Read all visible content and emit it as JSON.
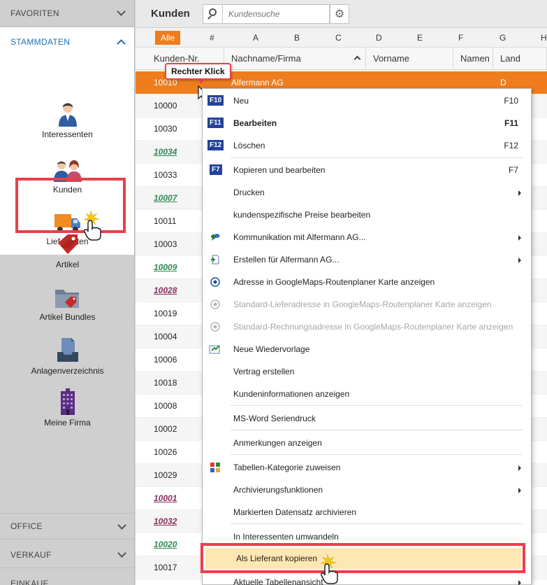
{
  "sidebar": {
    "favoriten": "FAVORITEN",
    "stammdaten": "STAMMDATEN",
    "items": [
      {
        "label": "Interessenten"
      },
      {
        "label": "Kunden"
      },
      {
        "label": "Lieferanten"
      },
      {
        "label": "Artikel"
      },
      {
        "label": "Artikel Bundles"
      },
      {
        "label": "Anlagenverzeichnis"
      },
      {
        "label": "Meine Firma"
      }
    ],
    "office": "OFFICE",
    "verkauf": "VERKAUF",
    "einkauf": "EINKAUF"
  },
  "header": {
    "title": "Kunden",
    "search_placeholder": "Kundensuche"
  },
  "letters": [
    "Alle",
    "#",
    "A",
    "B",
    "C",
    "D",
    "E",
    "F",
    "G",
    "H"
  ],
  "columns": {
    "nr": "Kunden-Nr.",
    "name": "Nachname/Firma",
    "vorname": "Vorname",
    "namen": "Namen",
    "land": "Land"
  },
  "rows": [
    {
      "nr": "10010",
      "name": "Alfermann AG",
      "land": "D"
    },
    {
      "nr": "10000"
    },
    {
      "nr": "10030"
    },
    {
      "nr": "10034"
    },
    {
      "nr": "10033"
    },
    {
      "nr": "10007"
    },
    {
      "nr": "10011"
    },
    {
      "nr": "10003"
    },
    {
      "nr": "10009"
    },
    {
      "nr": "10028"
    },
    {
      "nr": "10019"
    },
    {
      "nr": "10004"
    },
    {
      "nr": "10006"
    },
    {
      "nr": "10018"
    },
    {
      "nr": "10008"
    },
    {
      "nr": "10002"
    },
    {
      "nr": "10026"
    },
    {
      "nr": "10029"
    },
    {
      "nr": "10001"
    },
    {
      "nr": "10032"
    },
    {
      "nr": "10020"
    },
    {
      "nr": "10017"
    }
  ],
  "callout": "Rechter Klick",
  "menu": {
    "neu": "Neu",
    "neu_key": "F10",
    "bearbeiten": "Bearbeiten",
    "bearbeiten_key": "F11",
    "loeschen": "Löschen",
    "loeschen_key": "F12",
    "kopieren": "Kopieren und bearbeiten",
    "kopieren_key": "F7",
    "drucken": "Drucken",
    "preise": "kundenspezifische Preise bearbeiten",
    "kommunikation": "Kommunikation mit Alfermann AG...",
    "erstellen": "Erstellen für Alfermann AG...",
    "adresse": "Adresse in GoogleMaps-Routenplaner Karte anzeigen",
    "standard_liefer": "Standard-Lieferadresse in GoogleMaps-Routenplaner Karte anzeigen",
    "standard_rechnung": "Standard-Rechnungsadresse in GoogleMaps-Routenplaner Karte anzeigen",
    "wiedervorlage": "Neue Wiedervorlage",
    "vertrag": "Vertrag erstellen",
    "kundeninfo": "Kundeninformationen anzeigen",
    "msword": "MS-Word Seriendruck",
    "anmerkungen": "Anmerkungen anzeigen",
    "kategorie": "Tabellen-Kategorie zuweisen",
    "archivierung": "Archivierungsfunktionen",
    "archivieren": "Markierten Datensatz archivieren",
    "interessenten": "In Interessenten umwandeln",
    "lieferant": "Als Lieferant kopieren",
    "tabellenansicht": "Aktuelle Tabellenansicht"
  }
}
